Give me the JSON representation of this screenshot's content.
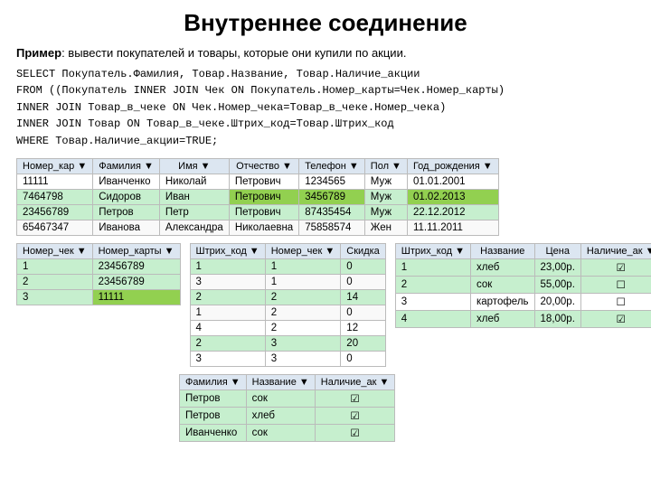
{
  "title": "Внутреннее соединение",
  "description": {
    "prefix_bold": "Пример",
    "prefix_rest": ": вывести покупателей и товары, которые они купили по акции.",
    "lines": [
      "SELECT Покупатель.Фамилия, Товар.Название, Товар.Наличие_акции",
      "FROM ((Покупатель INNER JOIN Чек ON Покупатель.Номер_карты=Чек.Номер_карты)",
      "INNER JOIN  Товар_в_чеке ON Чек.Номер_чека=Товар_в_чеке.Номер_чека)",
      "INNER JOIN Товар ON Товар_в_чеке.Штрих_код=Товар.Штрих_код",
      "WHERE Товар.Наличие_акции=TRUE;"
    ]
  },
  "table_customers": {
    "headers": [
      "Номер_кар ▼",
      "Фамилия ▼",
      "Имя ▼",
      "Отчество ▼",
      "Телефон ▼",
      "Пол ▼",
      "Год_рождения ▼"
    ],
    "rows": [
      [
        "11111",
        "Иванченко",
        "Николай",
        "Петрович",
        "1234565",
        "Муж",
        "01.01.2001"
      ],
      [
        "7464798",
        "Сидоров",
        "Иван",
        "Петрович",
        "3456789",
        "Муж",
        "01.02.2013"
      ],
      [
        "23456789",
        "Петров",
        "Петр",
        "Петрович",
        "87435454",
        "Муж",
        "22.12.2012"
      ],
      [
        "65467347",
        "Иванова",
        "Александра",
        "Николаевна",
        "75858574",
        "Жен",
        "11.11.2011"
      ]
    ],
    "highlight_rows": [
      1,
      2
    ],
    "highlight_cells": {
      "1": [
        3,
        4,
        6
      ],
      "2": []
    }
  },
  "table_checks": {
    "headers": [
      "Номер_чек ▼",
      "Номер_карты ▼"
    ],
    "rows": [
      [
        "1",
        "23456789"
      ],
      [
        "2",
        "23456789"
      ],
      [
        "3",
        "11111"
      ]
    ],
    "highlight_rows": [
      0,
      1,
      2
    ],
    "highlight_cells": {
      "2": [
        1
      ]
    }
  },
  "table_check_items": {
    "headers": [
      "Штрих_код ▼",
      "Номер_чек ▼",
      "Скидка"
    ],
    "rows": [
      [
        "1",
        "1",
        "0"
      ],
      [
        "3",
        "1",
        "0"
      ],
      [
        "2",
        "2",
        "14"
      ],
      [
        "1",
        "2",
        "0"
      ],
      [
        "4",
        "2",
        "12"
      ],
      [
        "2",
        "3",
        "20"
      ],
      [
        "3",
        "3",
        "0"
      ]
    ],
    "highlight_rows": [
      0,
      2,
      5
    ]
  },
  "table_goods": {
    "headers": [
      "Штрих_код ▼",
      "Название",
      "Цена",
      "Наличие_ак ▼"
    ],
    "rows": [
      [
        "1",
        "хлеб",
        "23,00р.",
        true
      ],
      [
        "2",
        "сок",
        "55,00р.",
        false
      ],
      [
        "3",
        "картофель",
        "20,00р.",
        false
      ],
      [
        "4",
        "хлеб",
        "18,00р.",
        true
      ]
    ],
    "highlight_rows": [
      0,
      1,
      3
    ]
  },
  "table_result": {
    "headers": [
      "Фамилия ▼",
      "Название ▼",
      "Наличие_ак ▼"
    ],
    "rows": [
      [
        "Петров",
        "сок",
        true
      ],
      [
        "Петров",
        "хлеб",
        true
      ],
      [
        "Иванченко",
        "сок",
        true
      ]
    ]
  }
}
